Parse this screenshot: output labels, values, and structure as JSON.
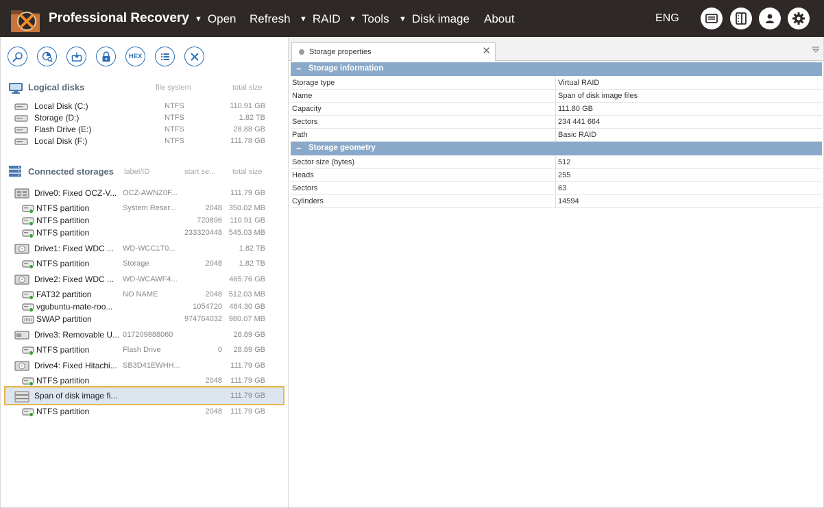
{
  "app": {
    "title": "Professional Recovery"
  },
  "menu": {
    "items": [
      {
        "label": "Open",
        "has_dropdown": true
      },
      {
        "label": "Refresh",
        "has_dropdown": false
      },
      {
        "label": "RAID",
        "has_dropdown": true
      },
      {
        "label": "Tools",
        "has_dropdown": true
      },
      {
        "label": "Disk image",
        "has_dropdown": true
      },
      {
        "label": "About",
        "has_dropdown": false
      }
    ],
    "language": "ENG",
    "dropdown_glyph": "▼"
  },
  "header_buttons": [
    "messages-icon",
    "panel-toggle-icon",
    "user-icon",
    "settings-icon"
  ],
  "toolbar": {
    "buttons": [
      "search-icon",
      "scan-icon",
      "save-files-icon",
      "lock-icon",
      "hex-editor-icon",
      "list-icon",
      "close-icon"
    ],
    "hex_label": "HEX"
  },
  "logical_disks": {
    "title": "Logical disks",
    "col_fs": "file system",
    "col_size": "total size",
    "items": [
      {
        "name": "Local Disk (C:)",
        "fs": "NTFS",
        "size": "110.91 GB"
      },
      {
        "name": "Storage (D:)",
        "fs": "NTFS",
        "size": "1.82 TB"
      },
      {
        "name": "Flash Drive (E:)",
        "fs": "NTFS",
        "size": "28.88 GB"
      },
      {
        "name": "Local Disk (F:)",
        "fs": "NTFS",
        "size": "111.78 GB"
      }
    ]
  },
  "connected_storages": {
    "title": "Connected storages",
    "col_label": "label/ID",
    "col_start": "start se...",
    "col_size": "total size",
    "items": [
      {
        "kind": "drive",
        "name": "Drive0: Fixed OCZ-V...",
        "label": "OCZ-AWNZ0F...",
        "start": "",
        "size": "111.79 GB"
      },
      {
        "kind": "partition",
        "name": "NTFS partition",
        "label": "System Reser...",
        "start": "2048",
        "size": "350.02 MB"
      },
      {
        "kind": "partition",
        "name": "NTFS partition",
        "label": "",
        "start": "720896",
        "size": "110.91 GB"
      },
      {
        "kind": "partition",
        "name": "NTFS partition",
        "label": "",
        "start": "233320448",
        "size": "545.03 MB"
      },
      {
        "kind": "drive",
        "name": "Drive1: Fixed WDC ...",
        "label": "WD-WCC1T0...",
        "start": "",
        "size": "1.82 TB"
      },
      {
        "kind": "partition",
        "name": "NTFS partition",
        "label": "Storage",
        "start": "2048",
        "size": "1.82 TB"
      },
      {
        "kind": "drive",
        "name": "Drive2: Fixed WDC ...",
        "label": "WD-WCAWF4...",
        "start": "",
        "size": "465.76 GB"
      },
      {
        "kind": "partition",
        "name": "FAT32 partition",
        "label": "NO NAME",
        "start": "2048",
        "size": "512.03 MB"
      },
      {
        "kind": "partition",
        "name": "vgubuntu-mate-roo...",
        "label": "",
        "start": "1054720",
        "size": "464.30 GB"
      },
      {
        "kind": "swap",
        "name": "SWAP partition",
        "label": "",
        "start": "974764032",
        "size": "980.07 MB"
      },
      {
        "kind": "removable",
        "name": "Drive3: Removable U...",
        "label": "017209888060",
        "start": "",
        "size": "28.89 GB"
      },
      {
        "kind": "partition",
        "name": "NTFS partition",
        "label": "Flash Drive",
        "start": "0",
        "size": "28.89 GB"
      },
      {
        "kind": "drive",
        "name": "Drive4: Fixed Hitachi...",
        "label": "SB3D41EWHH...",
        "start": "",
        "size": "111.79 GB"
      },
      {
        "kind": "partition",
        "name": "NTFS partition",
        "label": "",
        "start": "2048",
        "size": "111.79 GB"
      },
      {
        "kind": "raid",
        "name": "Span of disk image fi...",
        "label": "",
        "start": "",
        "size": "111.79 GB",
        "selected": true
      },
      {
        "kind": "partition",
        "name": "NTFS partition",
        "label": "",
        "start": "2048",
        "size": "111.79 GB"
      }
    ]
  },
  "properties": {
    "tab_label": "Storage properties",
    "close_glyph": "✕",
    "groups": [
      {
        "title": "Storage information",
        "toggle": "−",
        "rows": [
          {
            "key": "Storage type",
            "value": "Virtual RAID"
          },
          {
            "key": "Name",
            "value": "Span of disk image files"
          },
          {
            "key": "Capacity",
            "value": "111.80 GB"
          },
          {
            "key": "Sectors",
            "value": "234 441 664"
          },
          {
            "key": "Path",
            "value": "Basic RAID"
          }
        ]
      },
      {
        "title": "Storage geometry",
        "toggle": "−",
        "rows": [
          {
            "key": "Sector size (bytes)",
            "value": "512"
          },
          {
            "key": "Heads",
            "value": "255"
          },
          {
            "key": "Sectors",
            "value": "63"
          },
          {
            "key": "Cylinders",
            "value": "14594"
          }
        ]
      }
    ]
  },
  "colors": {
    "titlebar": "#2e2927",
    "accent_blue": "#2d6fb7",
    "group_header": "#8aa9c9",
    "selection_border": "#e8b54a",
    "selection_fill": "#dde6ef",
    "partition_green": "#3aa13a"
  }
}
